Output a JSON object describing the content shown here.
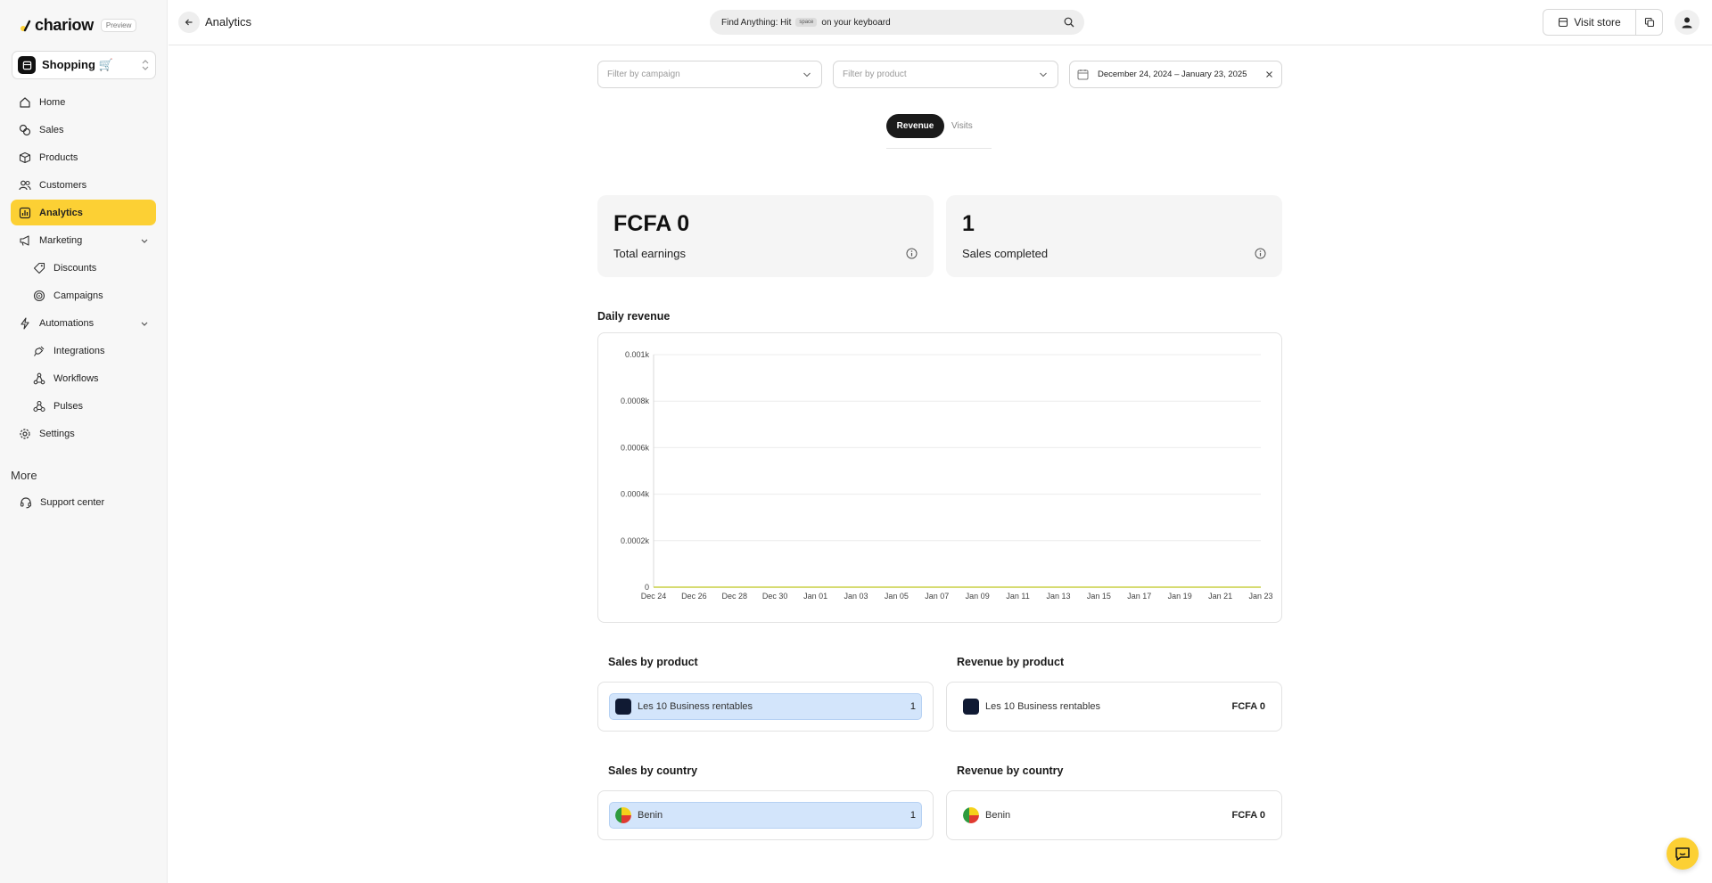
{
  "brand": {
    "name": "chariow",
    "badge": "Preview",
    "accent": "#fcd034"
  },
  "store": {
    "label": "Shopping 🛒"
  },
  "sidebar": {
    "items": [
      {
        "label": "Home",
        "icon": "home-icon"
      },
      {
        "label": "Sales",
        "icon": "coins-icon"
      },
      {
        "label": "Products",
        "icon": "box-icon"
      },
      {
        "label": "Customers",
        "icon": "users-icon"
      },
      {
        "label": "Analytics",
        "icon": "bar-chart-icon",
        "active": true
      },
      {
        "label": "Marketing",
        "icon": "megaphone-icon",
        "expandable": true
      },
      {
        "label": "Discounts",
        "icon": "tag-icon",
        "sub": true
      },
      {
        "label": "Campaigns",
        "icon": "target-icon",
        "sub": true
      },
      {
        "label": "Automations",
        "icon": "bolt-icon",
        "expandable": true
      },
      {
        "label": "Integrations",
        "icon": "plug-icon",
        "sub": true
      },
      {
        "label": "Workflows",
        "icon": "workflow-icon",
        "sub": true
      },
      {
        "label": "Pulses",
        "icon": "webhook-icon",
        "sub": true
      },
      {
        "label": "Settings",
        "icon": "gear-icon"
      }
    ],
    "more_title": "More",
    "support_label": "Support center"
  },
  "topbar": {
    "title": "Analytics",
    "search_prefix": "Find Anything: Hit",
    "search_key": "space",
    "search_suffix": "on your keyboard",
    "visit_store": "Visit store"
  },
  "filters": {
    "campaign_placeholder": "Filter by campaign",
    "product_placeholder": "Filter by product",
    "date_range": "December 24, 2024 – January 23, 2025"
  },
  "tabs": {
    "revenue": "Revenue",
    "visits": "Visits"
  },
  "stats": {
    "earnings_value": "FCFA 0",
    "earnings_label": "Total earnings",
    "sales_value": "1",
    "sales_label": "Sales completed"
  },
  "sections": {
    "daily_revenue": "Daily revenue",
    "sales_by_product": "Sales by product",
    "revenue_by_product": "Revenue by product",
    "sales_by_country": "Sales by country",
    "revenue_by_country": "Revenue by country"
  },
  "sales_by_product": [
    {
      "label": "Les 10 Business rentables",
      "value": "1"
    }
  ],
  "revenue_by_product": [
    {
      "label": "Les 10 Business rentables",
      "value": "FCFA 0"
    }
  ],
  "sales_by_country": [
    {
      "label": "Benin",
      "value": "1"
    }
  ],
  "revenue_by_country": [
    {
      "label": "Benin",
      "value": "FCFA 0"
    }
  ],
  "chart_data": {
    "type": "line",
    "title": "Daily revenue",
    "y_ticks": [
      "0",
      "0.0002k",
      "0.0004k",
      "0.0006k",
      "0.0008k",
      "0.001k"
    ],
    "x_ticks": [
      "Dec 24",
      "Dec 26",
      "Dec 28",
      "Dec 30",
      "Jan 01",
      "Jan 03",
      "Jan 05",
      "Jan 07",
      "Jan 09",
      "Jan 11",
      "Jan 13",
      "Jan 15",
      "Jan 17",
      "Jan 19",
      "Jan 21",
      "Jan 23"
    ],
    "ylim": [
      0,
      1
    ],
    "series": [
      {
        "color": "#c9cf43",
        "x": [
          "2024-12-24",
          "2024-12-25",
          "2024-12-26",
          "2024-12-27",
          "2024-12-28",
          "2024-12-29",
          "2024-12-30",
          "2024-12-31",
          "2025-01-01",
          "2025-01-02",
          "2025-01-03",
          "2025-01-04",
          "2025-01-05",
          "2025-01-06",
          "2025-01-07",
          "2025-01-08",
          "2025-01-09",
          "2025-01-10",
          "2025-01-11",
          "2025-01-12",
          "2025-01-13",
          "2025-01-14",
          "2025-01-15",
          "2025-01-16",
          "2025-01-17",
          "2025-01-18",
          "2025-01-19",
          "2025-01-20",
          "2025-01-21",
          "2025-01-22",
          "2025-01-23"
        ],
        "values": [
          0,
          0,
          0,
          0,
          0,
          0,
          0,
          0,
          0,
          0,
          0,
          0,
          0,
          0,
          0,
          0,
          0,
          0,
          0,
          0,
          0,
          0,
          0,
          0,
          0,
          0,
          0,
          0,
          0,
          0,
          0
        ]
      }
    ],
    "grid": true
  }
}
